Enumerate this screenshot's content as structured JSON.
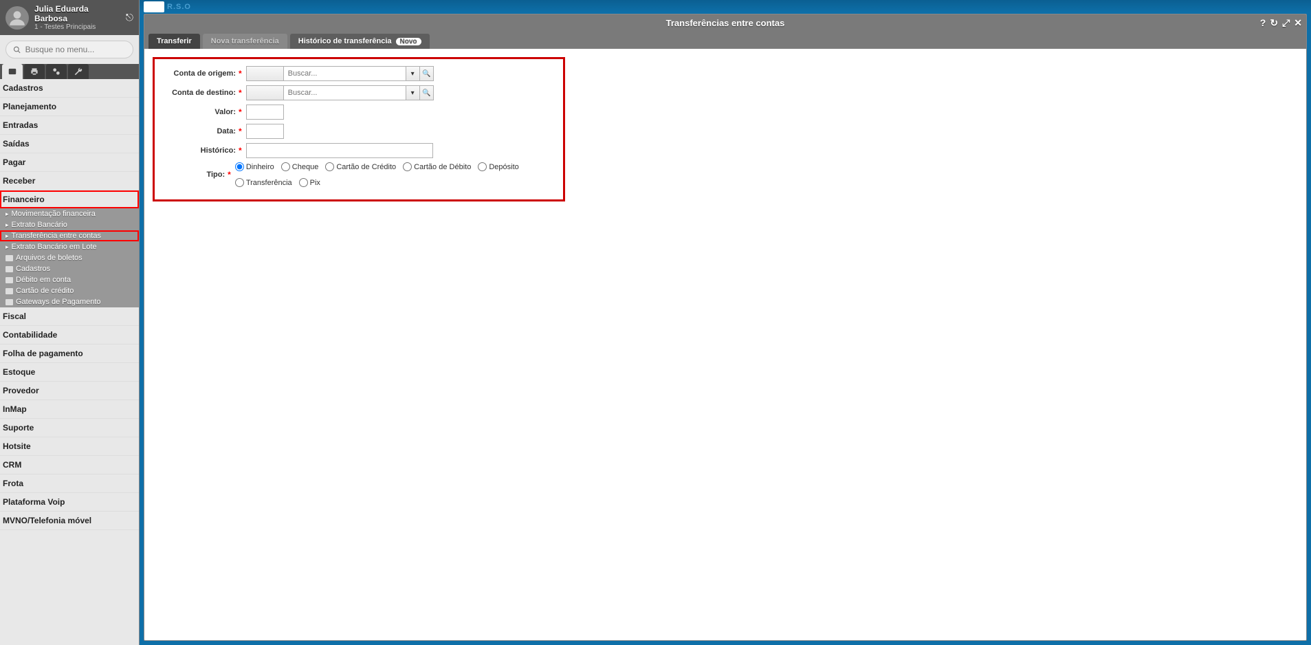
{
  "user": {
    "name": "Julia Eduarda Barbosa",
    "sub": "1 - Testes Principais"
  },
  "search": {
    "placeholder": "Busque no menu..."
  },
  "menu": {
    "groups": [
      "Cadastros",
      "Planejamento",
      "Entradas",
      "Saídas",
      "Pagar",
      "Receber",
      "Financeiro",
      "Fiscal",
      "Contabilidade",
      "Folha de pagamento",
      "Estoque",
      "Provedor",
      "InMap",
      "Suporte",
      "Hotsite",
      "CRM",
      "Frota",
      "Plataforma Voip",
      "MVNO/Telefonia móvel"
    ],
    "financeiro_sub": [
      {
        "label": "Movimentação financeira",
        "icon": "arrow"
      },
      {
        "label": "Extrato Bancário",
        "icon": "arrow"
      },
      {
        "label": "Transferência entre contas",
        "icon": "arrow",
        "highlight": true
      },
      {
        "label": "Extrato Bancário em Lote",
        "icon": "arrow"
      },
      {
        "label": "Arquivos de boletos",
        "icon": "folder"
      },
      {
        "label": "Cadastros",
        "icon": "folder"
      },
      {
        "label": "Débito em conta",
        "icon": "folder"
      },
      {
        "label": "Cartão de crédito",
        "icon": "folder"
      },
      {
        "label": "Gateways de Pagamento",
        "icon": "folder"
      }
    ]
  },
  "topbar": {
    "logo_text": "R.S.O"
  },
  "panel": {
    "title": "Transferências entre contas",
    "tabs": {
      "transferir": "Transferir",
      "nova": "Nova transferência",
      "historico": "Histórico de transferência",
      "historico_badge": "Novo"
    }
  },
  "form": {
    "labels": {
      "origem": "Conta de origem:",
      "destino": "Conta de destino:",
      "valor": "Valor:",
      "data": "Data:",
      "historico": "Histórico:",
      "tipo": "Tipo:"
    },
    "placeholder_buscar": "Buscar...",
    "tipo_options": [
      "Dinheiro",
      "Cheque",
      "Cartão de Crédito",
      "Cartão de Débito",
      "Depósito",
      "Transferência",
      "Pix"
    ],
    "tipo_selected_index": 0
  }
}
